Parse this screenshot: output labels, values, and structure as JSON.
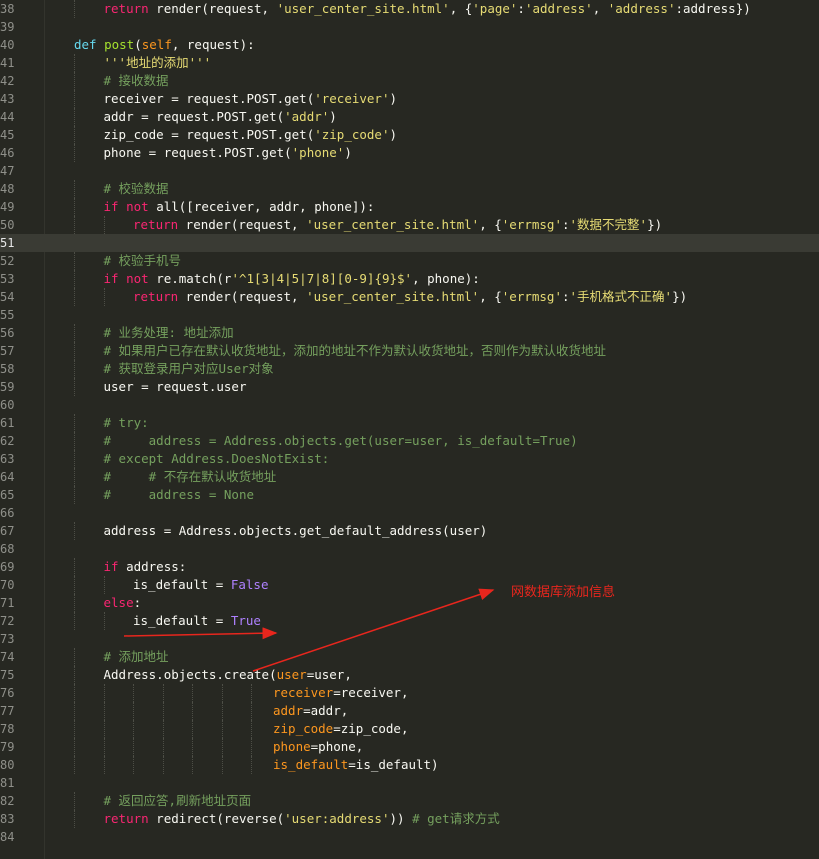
{
  "annotation": "网数据库添加信息",
  "colors": {
    "background": "#272822",
    "annotation": "#e8261d"
  },
  "lines": [
    {
      "n": "38",
      "indent": 2,
      "tokens": [
        [
          "kwr",
          "return"
        ],
        [
          "t",
          " render(request, "
        ],
        [
          "str",
          "'user_center_site.html'"
        ],
        [
          "t",
          ", {"
        ],
        [
          "str",
          "'page'"
        ],
        [
          "t",
          ":"
        ],
        [
          "str",
          "'address'"
        ],
        [
          "t",
          ", "
        ],
        [
          "str",
          "'address'"
        ],
        [
          "t",
          ":address})"
        ]
      ]
    },
    {
      "n": "39",
      "indent": 0,
      "tokens": []
    },
    {
      "n": "40",
      "indent": 1,
      "tokens": [
        [
          "kw",
          "def "
        ],
        [
          "fn",
          "post"
        ],
        [
          "t",
          "("
        ],
        [
          "self",
          "self"
        ],
        [
          "t",
          ", request):"
        ]
      ]
    },
    {
      "n": "41",
      "indent": 2,
      "tokens": [
        [
          "str",
          "'''地址的添加'''"
        ]
      ]
    },
    {
      "n": "42",
      "indent": 2,
      "tokens": [
        [
          "cmtg",
          "# 接收数据"
        ]
      ]
    },
    {
      "n": "43",
      "indent": 2,
      "tokens": [
        [
          "t",
          "receiver = request.POST.get("
        ],
        [
          "str",
          "'receiver'"
        ],
        [
          "t",
          ")"
        ]
      ]
    },
    {
      "n": "44",
      "indent": 2,
      "tokens": [
        [
          "t",
          "addr = request.POST.get("
        ],
        [
          "str",
          "'addr'"
        ],
        [
          "t",
          ")"
        ]
      ]
    },
    {
      "n": "45",
      "indent": 2,
      "tokens": [
        [
          "t",
          "zip_code = request.POST.get("
        ],
        [
          "str",
          "'zip_code'"
        ],
        [
          "t",
          ")"
        ]
      ]
    },
    {
      "n": "46",
      "indent": 2,
      "tokens": [
        [
          "t",
          "phone = request.POST.get("
        ],
        [
          "str",
          "'phone'"
        ],
        [
          "t",
          ")"
        ]
      ]
    },
    {
      "n": "47",
      "indent": 0,
      "tokens": []
    },
    {
      "n": "48",
      "indent": 2,
      "tokens": [
        [
          "cmtg",
          "# 校验数据"
        ]
      ]
    },
    {
      "n": "49",
      "indent": 2,
      "tokens": [
        [
          "kwr",
          "if not "
        ],
        [
          "t",
          "all([receiver, addr, phone]):"
        ]
      ]
    },
    {
      "n": "50",
      "indent": 3,
      "tokens": [
        [
          "kwr",
          "return"
        ],
        [
          "t",
          " render(request, "
        ],
        [
          "str",
          "'user_center_site.html'"
        ],
        [
          "t",
          ", {"
        ],
        [
          "str",
          "'errmsg'"
        ],
        [
          "t",
          ":"
        ],
        [
          "str",
          "'数据不完整'"
        ],
        [
          "t",
          "})"
        ]
      ]
    },
    {
      "n": "51",
      "indent": 0,
      "tokens": [],
      "current": true
    },
    {
      "n": "52",
      "indent": 2,
      "tokens": [
        [
          "cmtg",
          "# 校验手机号"
        ]
      ]
    },
    {
      "n": "53",
      "indent": 2,
      "tokens": [
        [
          "kwr",
          "if not "
        ],
        [
          "t",
          "re.match(r"
        ],
        [
          "str",
          "'^1[3|4|5|7|8][0-9]{9}$'"
        ],
        [
          "t",
          ", phone):"
        ]
      ]
    },
    {
      "n": "54",
      "indent": 3,
      "tokens": [
        [
          "kwr",
          "return"
        ],
        [
          "t",
          " render(request, "
        ],
        [
          "str",
          "'user_center_site.html'"
        ],
        [
          "t",
          ", {"
        ],
        [
          "str",
          "'errmsg'"
        ],
        [
          "t",
          ":"
        ],
        [
          "str",
          "'手机格式不正确'"
        ],
        [
          "t",
          "})"
        ]
      ]
    },
    {
      "n": "55",
      "indent": 0,
      "tokens": []
    },
    {
      "n": "56",
      "indent": 2,
      "tokens": [
        [
          "cmtg",
          "# 业务处理: 地址添加"
        ]
      ]
    },
    {
      "n": "57",
      "indent": 2,
      "tokens": [
        [
          "cmtg",
          "# 如果用户已存在默认收货地址，添加的地址不作为默认收货地址，否则作为默认收货地址"
        ]
      ]
    },
    {
      "n": "58",
      "indent": 2,
      "tokens": [
        [
          "cmtg",
          "# 获取登录用户对应User对象"
        ]
      ]
    },
    {
      "n": "59",
      "indent": 2,
      "tokens": [
        [
          "t",
          "user = request.user"
        ]
      ]
    },
    {
      "n": "60",
      "indent": 0,
      "tokens": []
    },
    {
      "n": "61",
      "indent": 2,
      "tokens": [
        [
          "cmtg",
          "# try:"
        ]
      ]
    },
    {
      "n": "62",
      "indent": 2,
      "tokens": [
        [
          "cmtg",
          "#     address = Address.objects.get(user=user, is_default=True)"
        ]
      ]
    },
    {
      "n": "63",
      "indent": 2,
      "tokens": [
        [
          "cmtg",
          "# except Address.DoesNotExist:"
        ]
      ]
    },
    {
      "n": "64",
      "indent": 2,
      "tokens": [
        [
          "cmtg",
          "#     # 不存在默认收货地址"
        ]
      ]
    },
    {
      "n": "65",
      "indent": 2,
      "tokens": [
        [
          "cmtg",
          "#     address = None"
        ]
      ]
    },
    {
      "n": "66",
      "indent": 0,
      "tokens": []
    },
    {
      "n": "67",
      "indent": 2,
      "tokens": [
        [
          "t",
          "address = Address.objects.get_default_address(user)"
        ]
      ]
    },
    {
      "n": "68",
      "indent": 0,
      "tokens": []
    },
    {
      "n": "69",
      "indent": 2,
      "tokens": [
        [
          "kwr",
          "if "
        ],
        [
          "t",
          "address:"
        ]
      ]
    },
    {
      "n": "70",
      "indent": 3,
      "tokens": [
        [
          "t",
          "is_default = "
        ],
        [
          "bool",
          "False"
        ]
      ]
    },
    {
      "n": "71",
      "indent": 2,
      "tokens": [
        [
          "kwr",
          "else"
        ],
        [
          "t",
          ":"
        ]
      ]
    },
    {
      "n": "72",
      "indent": 3,
      "tokens": [
        [
          "t",
          "is_default = "
        ],
        [
          "bool",
          "True"
        ]
      ]
    },
    {
      "n": "73",
      "indent": 0,
      "tokens": []
    },
    {
      "n": "74",
      "indent": 2,
      "tokens": [
        [
          "cmtg",
          "# 添加地址"
        ]
      ]
    },
    {
      "n": "75",
      "indent": 2,
      "tokens": [
        [
          "t",
          "Address.objects.create("
        ],
        [
          "kwarg",
          "user"
        ],
        [
          "t",
          "=user,"
        ]
      ]
    },
    {
      "n": "76",
      "indent": 8,
      "tokens": [
        [
          "kwarg",
          "receiver"
        ],
        [
          "t",
          "=receiver,"
        ]
      ]
    },
    {
      "n": "77",
      "indent": 8,
      "tokens": [
        [
          "kwarg",
          "addr"
        ],
        [
          "t",
          "=addr,"
        ]
      ]
    },
    {
      "n": "78",
      "indent": 8,
      "tokens": [
        [
          "kwarg",
          "zip_code"
        ],
        [
          "t",
          "=zip_code,"
        ]
      ]
    },
    {
      "n": "79",
      "indent": 8,
      "tokens": [
        [
          "kwarg",
          "phone"
        ],
        [
          "t",
          "=phone,"
        ]
      ]
    },
    {
      "n": "80",
      "indent": 8,
      "tokens": [
        [
          "kwarg",
          "is_default"
        ],
        [
          "t",
          "=is_default)"
        ]
      ]
    },
    {
      "n": "81",
      "indent": 0,
      "tokens": []
    },
    {
      "n": "82",
      "indent": 2,
      "tokens": [
        [
          "cmtg",
          "# 返回应答,刷新地址页面"
        ]
      ]
    },
    {
      "n": "83",
      "indent": 2,
      "tokens": [
        [
          "kwr",
          "return"
        ],
        [
          "t",
          " redirect(reverse("
        ],
        [
          "str",
          "'user:address'"
        ],
        [
          "t",
          "))"
        ],
        [
          "cmtg",
          " # get请求方式"
        ]
      ]
    },
    {
      "n": "84",
      "indent": 0,
      "tokens": []
    }
  ]
}
